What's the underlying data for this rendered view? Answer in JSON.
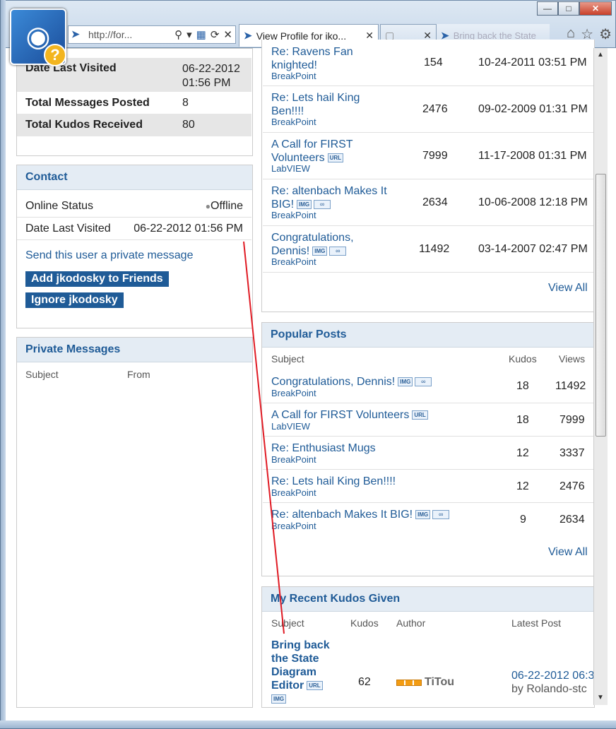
{
  "browser": {
    "address": "http://for...",
    "active_tab_title": "View Profile for jko...",
    "ghost_tab_title": "Bring back the State"
  },
  "stats": [
    {
      "key": "Date Last Visited",
      "value": "06-22-2012\n01:56 PM"
    },
    {
      "key": "Total Messages Posted",
      "value": "8"
    },
    {
      "key": "Total Kudos Received",
      "value": "80"
    }
  ],
  "contact": {
    "title": "Contact",
    "online_label": "Online Status",
    "online_value": "Offline",
    "visited_label": "Date Last Visited",
    "visited_value": "06-22-2012 01:56 PM",
    "pm_link": "Send this user a private message",
    "add_friend": "Add jkodosky to Friends",
    "ignore": "Ignore jkodosky"
  },
  "private_messages": {
    "title": "Private Messages",
    "col_subject": "Subject",
    "col_from": "From"
  },
  "recent_posts": [
    {
      "subject_l1": "Re: Ravens Fan",
      "subject_l2": "knighted!",
      "board": "BreakPoint",
      "views": "154",
      "date": "10-24-2011 03:51 PM",
      "badges": []
    },
    {
      "subject_l1": "Re: Lets hail King",
      "subject_l2": "Ben!!!!",
      "board": "BreakPoint",
      "views": "2476",
      "date": "09-02-2009 01:31 PM",
      "badges": []
    },
    {
      "subject_l1": "A Call for FIRST",
      "subject_l2": "Volunteers",
      "board": "LabVIEW",
      "views": "7999",
      "date": "11-17-2008 01:31 PM",
      "badges": [
        "URL"
      ]
    },
    {
      "subject_l1": "Re: altenbach Makes It",
      "subject_l2": "BIG!",
      "board": "BreakPoint",
      "views": "2634",
      "date": "10-06-2008 12:18 PM",
      "badges": [
        "IMG",
        "clip"
      ]
    },
    {
      "subject_l1": "Congratulations,",
      "subject_l2": "Dennis!",
      "board": "BreakPoint",
      "views": "11492",
      "date": "03-14-2007 02:47 PM",
      "badges": [
        "IMG",
        "clip"
      ]
    }
  ],
  "view_all": "View All",
  "popular": {
    "title": "Popular Posts",
    "col_subject": "Subject",
    "col_kudos": "Kudos",
    "col_views": "Views",
    "rows": [
      {
        "subject": "Congratulations, Dennis!",
        "board": "BreakPoint",
        "kudos": "18",
        "views": "11492",
        "badges": [
          "IMG",
          "clip"
        ]
      },
      {
        "subject": "A Call for FIRST Volunteers",
        "board": "LabVIEW",
        "kudos": "18",
        "views": "7999",
        "badges": [
          "URL"
        ]
      },
      {
        "subject": "Re: Enthusiast Mugs",
        "board": "BreakPoint",
        "kudos": "12",
        "views": "3337",
        "badges": []
      },
      {
        "subject": "Re: Lets hail King Ben!!!!",
        "board": "BreakPoint",
        "kudos": "12",
        "views": "2476",
        "badges": []
      },
      {
        "subject": "Re: altenbach Makes It BIG!",
        "board": "BreakPoint",
        "kudos": "9",
        "views": "2634",
        "badges": [
          "IMG",
          "clip"
        ]
      }
    ]
  },
  "kudos_given": {
    "title": "My Recent Kudos Given",
    "col_subject": "Subject",
    "col_kudos": "Kudos",
    "col_author": "Author",
    "col_latest": "Latest Post",
    "row": {
      "subject_lines": [
        "Bring back",
        "the State",
        "Diagram",
        "Editor"
      ],
      "kudos": "62",
      "author": "TiTou",
      "latest_date": "06-22-2012 06:3",
      "latest_by": "by Rolando-stc"
    }
  },
  "colors": {
    "link": "#1f5b97",
    "header_bg": "#e4ecf4",
    "button": "#1f5b97",
    "annotation": "#e01b24"
  }
}
